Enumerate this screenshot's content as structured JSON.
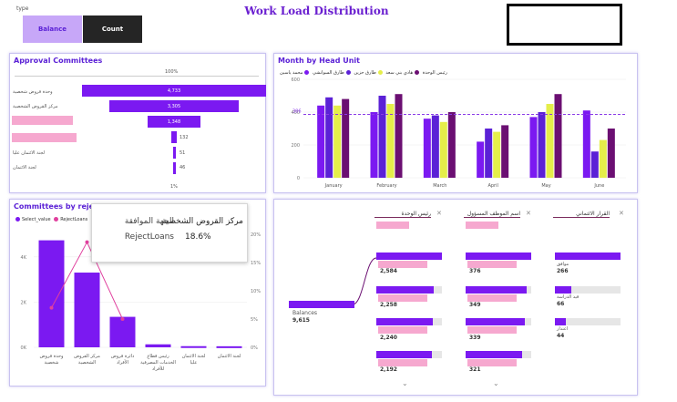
{
  "header": {
    "title": "Work Load Distribution",
    "slicer_label": "type"
  },
  "slicer": {
    "options": [
      {
        "label": "Balance"
      },
      {
        "label": "Count"
      }
    ]
  },
  "approval": {
    "title": "Approval Committees",
    "top_pct": "100%",
    "bottom_pct": "1%",
    "items": [
      {
        "label": "وحدة قروض شخصية",
        "value": "4,733",
        "v": 4733
      },
      {
        "label": "مركز القروض الشخصية",
        "value": "3,305",
        "v": 3305
      },
      {
        "label": "",
        "value": "1,348",
        "v": 1348
      },
      {
        "label": "",
        "value": "132",
        "v": 132
      },
      {
        "label": "لجنة الائتمان عليا",
        "value": "51",
        "v": 51
      },
      {
        "label": "لجنة الائتمان",
        "value": "46",
        "v": 46
      }
    ]
  },
  "month": {
    "title": "Month by Head Unit",
    "legend_title": "رئيس الوحدة",
    "series": [
      {
        "name": "محمد ياسين",
        "color": "#7b19f1"
      },
      {
        "name": "طارق السوانشي",
        "color": "#5b21d6"
      },
      {
        "name": "طارق حزين",
        "color": "#e5ee4a"
      },
      {
        "name": "هادي بني سعد",
        "color": "#6b0f72"
      }
    ],
    "ref_label": "386",
    "yticks": [
      "600",
      "400",
      "200",
      "0"
    ]
  },
  "chart_data": [
    {
      "type": "bar",
      "title": "Month by Head Unit",
      "categories": [
        "January",
        "February",
        "March",
        "April",
        "May",
        "June"
      ],
      "ylim": [
        0,
        600
      ],
      "reference_line": 386,
      "series": [
        {
          "name": "محمد ياسين",
          "values": [
            440,
            400,
            360,
            220,
            370,
            410
          ]
        },
        {
          "name": "طارق السوانشي",
          "values": [
            490,
            500,
            380,
            300,
            400,
            160
          ]
        },
        {
          "name": "طارق حزين",
          "values": [
            440,
            450,
            340,
            280,
            450,
            230
          ]
        },
        {
          "name": "هادي بني سعد",
          "values": [
            480,
            510,
            400,
            320,
            510,
            300
          ]
        }
      ]
    },
    {
      "type": "bar",
      "title": "Committees by rejection",
      "categories": [
        "وحدة قروض شخصية",
        "مركز القروض الشخصية",
        "دائرة قروض الأفراد",
        "رئيس قطاع الخدمات المصرفية للأفراد",
        "لجنة الائتمان عليا",
        "لجنة الائتمان"
      ],
      "ylim": [
        0,
        5000
      ],
      "series": [
        {
          "name": "Select_value",
          "values": [
            4733,
            3305,
            1348,
            132,
            51,
            46
          ]
        },
        {
          "name": "RejectLoans",
          "values": [
            7,
            18.6,
            5,
            0,
            0,
            0
          ]
        }
      ]
    }
  ],
  "rejection": {
    "title": "Committees by rejection",
    "legend": [
      {
        "name": "Select_value",
        "color": "#7b19f1"
      },
      {
        "name": "RejectLoans",
        "color": "#e0409e"
      }
    ],
    "yticks_left": [
      "4K",
      "2K",
      "0K"
    ],
    "yticks_right": [
      "20%",
      "15%",
      "10%",
      "5%",
      "0%"
    ],
    "xlabels": [
      "وحدة قروض شخصية",
      "مركز القروض الشخصية",
      "دائرة قروض الأفراد",
      "رئيس قطاع الخدمات المصرفية للأفراد",
      "لجنة الائتمان عليا",
      "لجنة الائتمان"
    ],
    "tooltip": {
      "k1": "الجهة الموافقة",
      "v1": "مركز القروض الشخصية",
      "k2": "RejectLoans",
      "v2": "18.6%"
    }
  },
  "decomp": {
    "headers": [
      "رئيس الوحدة",
      "اسم الموظف المسؤول",
      "القرار الائتماني"
    ],
    "root_label": "Balances",
    "root_value": "9,615",
    "col1": [
      "2,584",
      "2,258",
      "2,240",
      "2,192"
    ],
    "col2": [
      "376",
      "349",
      "339",
      "321"
    ],
    "col3": [
      {
        "label": "موافق",
        "value": "266"
      },
      {
        "label": "قيد الدراسة",
        "value": "66"
      },
      {
        "label": "اعتذار",
        "value": "44"
      }
    ]
  },
  "colors": {
    "accent": "#7b19f1",
    "pink": "#e0409e",
    "lavender": "#c8a8f7",
    "dark": "#252525"
  }
}
